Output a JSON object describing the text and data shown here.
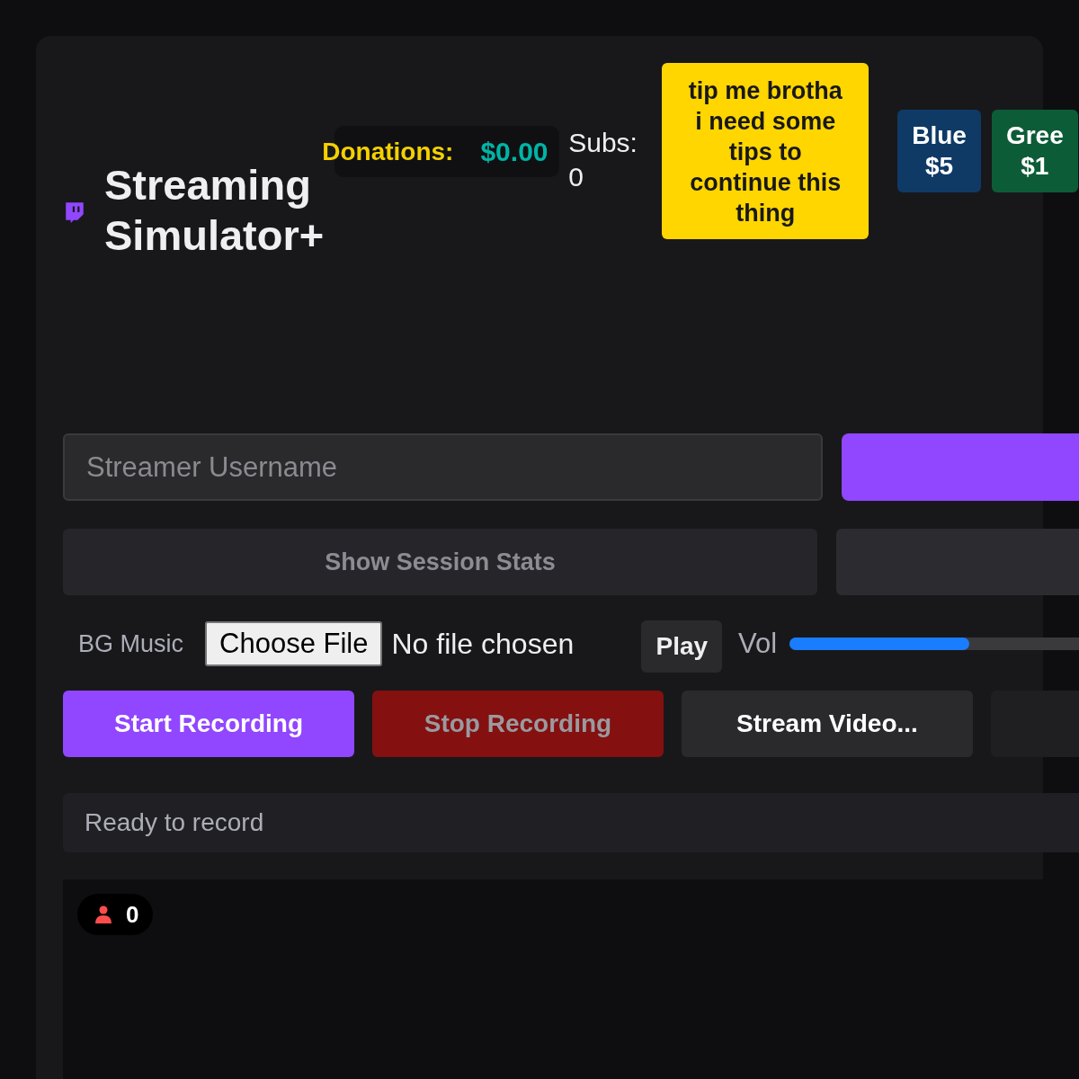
{
  "header": {
    "title_lines": [
      "Streaming",
      "Simulator+"
    ],
    "donations": {
      "label": "Donations:",
      "amount": "$0.00"
    },
    "subs": {
      "label": "Subs:",
      "count": "0"
    },
    "tip_message": [
      "tip me brotha",
      "i need some",
      "tips to",
      "continue this",
      "thing"
    ],
    "donation_chips": [
      {
        "label": "Blue",
        "amount": "$5",
        "color": "#0f3a66"
      },
      {
        "label": "Gree",
        "amount": "$1",
        "color": "#0d5c38"
      }
    ]
  },
  "username": {
    "placeholder": "Streamer Username"
  },
  "session_stats_button": "Show Session Stats",
  "music": {
    "label": "BG Music",
    "file_button": "Choose File",
    "file_status": "No file chosen",
    "play": "Play",
    "volume_label": "Vol",
    "level": 0.5
  },
  "recording_buttons": [
    {
      "label": "Start Recording",
      "kind": "primary",
      "disabled": false
    },
    {
      "label": "Stop Recording",
      "kind": "danger",
      "disabled": true
    },
    {
      "label": "Stream Video...",
      "kind": "secondary",
      "disabled": false
    }
  ],
  "status": "Ready to record",
  "viewers": "0"
}
